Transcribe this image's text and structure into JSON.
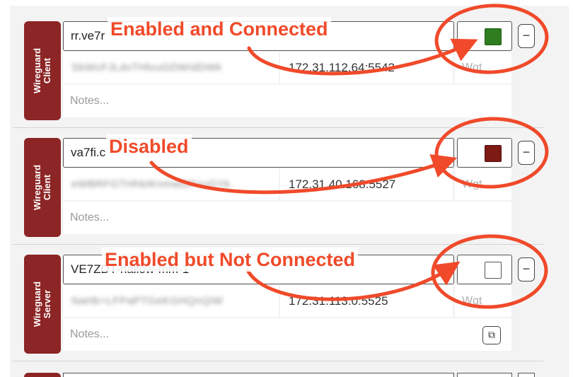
{
  "entries": [
    {
      "type_label": "Wireguard\nClient",
      "name": "rr.ve7r",
      "public_key": "SbWcFJLdvTHlvuGDWIdDWk",
      "endpoint": "172.31.112.64:5542",
      "weight_placeholder": "Wgt",
      "notes_placeholder": "Notes...",
      "status": "enabled-connected",
      "status_color": "#2e7d1f",
      "annotation": "Enabled and Connected"
    },
    {
      "type_label": "Wireguard\nClient",
      "name": "va7fi.c",
      "public_key": "eWBRFGTHhbIKnmwDPnuGYk",
      "endpoint": "172.31.40.168:5527",
      "weight_placeholder": "Wgt",
      "notes_placeholder": "Notes...",
      "status": "disabled",
      "status_color": "#7d1a14",
      "annotation": "Disabled"
    },
    {
      "type_label": "Wireguard\nServer",
      "name": "VE7ZDT-hallow-mm-1",
      "public_key": "NaHb+LFPaPTGeKGHQnQiW",
      "endpoint": "172.31.113.0:5525",
      "weight_placeholder": "Wgt",
      "notes_placeholder": "Notes...",
      "status": "enabled-not-connected",
      "status_color": "#ffffff",
      "annotation": "Enabled but Not Connected"
    }
  ],
  "icons": {
    "remove": "minus-icon",
    "copy": "copy-icon"
  },
  "colors": {
    "type_badge": "#8c2525",
    "annotation": "#f04a2a"
  }
}
